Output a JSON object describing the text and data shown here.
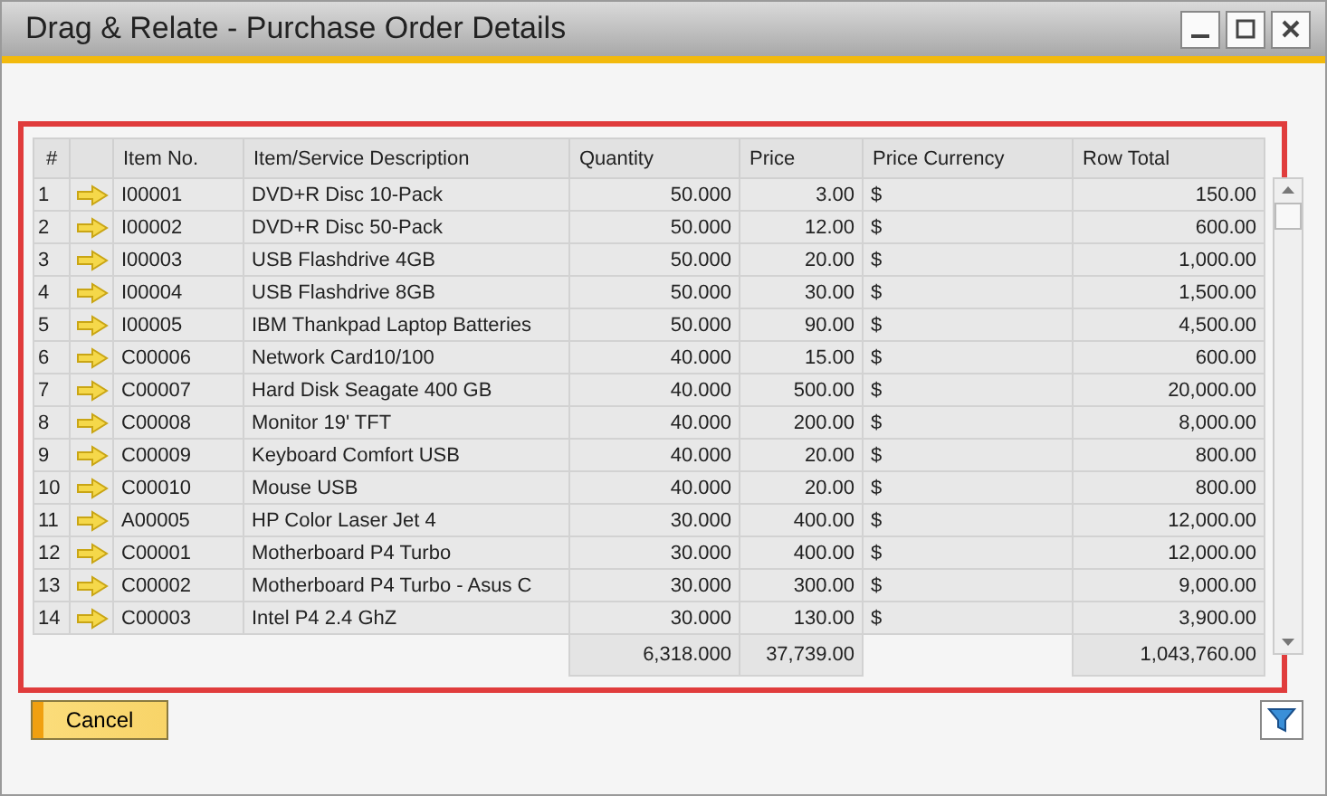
{
  "window": {
    "title": "Drag & Relate - Purchase Order Details"
  },
  "table": {
    "columns": [
      "#",
      "Item No.",
      "Item/Service Description",
      "Quantity",
      "Price",
      "Price Currency",
      "Row Total"
    ],
    "rows": [
      {
        "num": "1",
        "item_no": "I00001",
        "description": "DVD+R Disc 10-Pack",
        "quantity": "50.000",
        "price": "3.00",
        "currency": "$",
        "row_total": "150.00"
      },
      {
        "num": "2",
        "item_no": "I00002",
        "description": "DVD+R Disc 50-Pack",
        "quantity": "50.000",
        "price": "12.00",
        "currency": "$",
        "row_total": "600.00"
      },
      {
        "num": "3",
        "item_no": "I00003",
        "description": "USB Flashdrive 4GB",
        "quantity": "50.000",
        "price": "20.00",
        "currency": "$",
        "row_total": "1,000.00"
      },
      {
        "num": "4",
        "item_no": "I00004",
        "description": "USB Flashdrive 8GB",
        "quantity": "50.000",
        "price": "30.00",
        "currency": "$",
        "row_total": "1,500.00"
      },
      {
        "num": "5",
        "item_no": "I00005",
        "description": "IBM Thankpad Laptop Batteries",
        "quantity": "50.000",
        "price": "90.00",
        "currency": "$",
        "row_total": "4,500.00"
      },
      {
        "num": "6",
        "item_no": "C00006",
        "description": "Network Card10/100",
        "quantity": "40.000",
        "price": "15.00",
        "currency": "$",
        "row_total": "600.00"
      },
      {
        "num": "7",
        "item_no": "C00007",
        "description": "Hard Disk Seagate 400 GB",
        "quantity": "40.000",
        "price": "500.00",
        "currency": "$",
        "row_total": "20,000.00"
      },
      {
        "num": "8",
        "item_no": "C00008",
        "description": "Monitor 19' TFT",
        "quantity": "40.000",
        "price": "200.00",
        "currency": "$",
        "row_total": "8,000.00"
      },
      {
        "num": "9",
        "item_no": "C00009",
        "description": "Keyboard Comfort USB",
        "quantity": "40.000",
        "price": "20.00",
        "currency": "$",
        "row_total": "800.00"
      },
      {
        "num": "10",
        "item_no": "C00010",
        "description": "Mouse USB",
        "quantity": "40.000",
        "price": "20.00",
        "currency": "$",
        "row_total": "800.00"
      },
      {
        "num": "11",
        "item_no": "A00005",
        "description": "HP Color Laser Jet 4",
        "quantity": "30.000",
        "price": "400.00",
        "currency": "$",
        "row_total": "12,000.00"
      },
      {
        "num": "12",
        "item_no": "C00001",
        "description": "Motherboard P4 Turbo",
        "quantity": "30.000",
        "price": "400.00",
        "currency": "$",
        "row_total": "12,000.00"
      },
      {
        "num": "13",
        "item_no": "C00002",
        "description": "Motherboard P4 Turbo - Asus C",
        "quantity": "30.000",
        "price": "300.00",
        "currency": "$",
        "row_total": "9,000.00"
      },
      {
        "num": "14",
        "item_no": "C00003",
        "description": "Intel P4 2.4 GhZ",
        "quantity": "30.000",
        "price": "130.00",
        "currency": "$",
        "row_total": "3,900.00"
      }
    ],
    "totals": {
      "quantity": "6,318.000",
      "price": "37,739.00",
      "row_total": "1,043,760.00"
    }
  },
  "buttons": [
    "Cancel"
  ]
}
